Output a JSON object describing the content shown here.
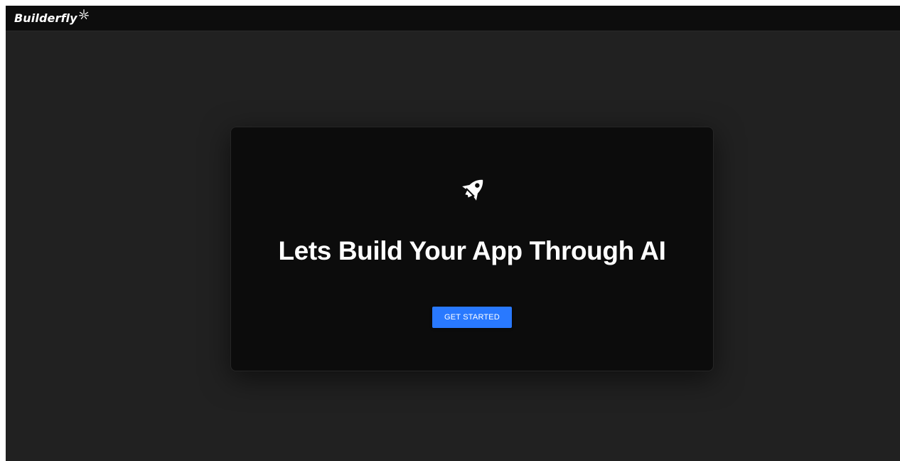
{
  "app": {
    "name": "Builderfly",
    "logo_icon": "sparkle-icon"
  },
  "hero": {
    "icon": "rocket-icon",
    "headline": "Lets Build Your App Through AI",
    "cta_label": "GET STARTED"
  },
  "colors": {
    "page_background": "#212121",
    "topbar_background": "#0d0d0d",
    "card_background": "#0c0c0c",
    "accent": "#2979ff",
    "text": "#ffffff"
  }
}
